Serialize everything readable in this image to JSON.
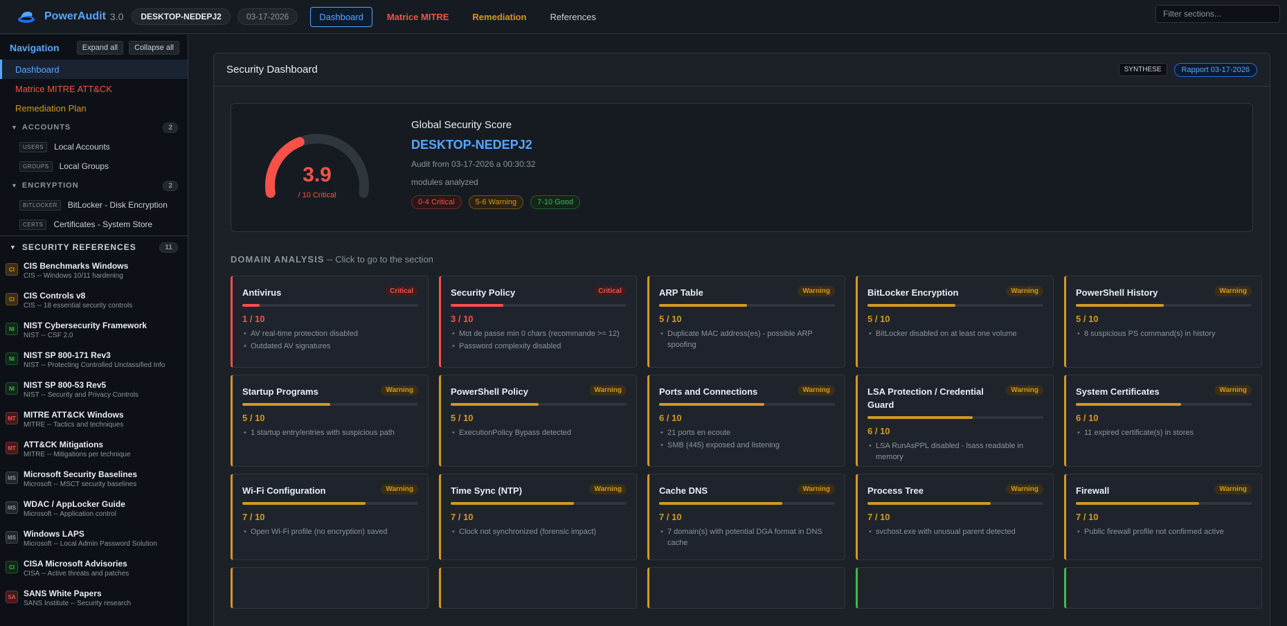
{
  "topbar": {
    "brand": "PowerAudit",
    "version": "3.0",
    "host": "DESKTOP-NEDEPJ2",
    "date": "03-17-2026",
    "tabs": [
      "Dashboard",
      "Matrice MITRE",
      "Remediation",
      "References"
    ],
    "filter_placeholder": "Filter sections..."
  },
  "sidebar": {
    "title": "Navigation",
    "expand_label": "Expand all",
    "collapse_label": "Collapse all",
    "top_items": [
      "Dashboard",
      "Matrice MITRE ATT&CK",
      "Remediation Plan"
    ],
    "groups": [
      {
        "label": "ACCOUNTS",
        "count": "2",
        "items": [
          {
            "tag": "USERS",
            "label": "Local Accounts"
          },
          {
            "tag": "GROUPS",
            "label": "Local Groups"
          }
        ]
      },
      {
        "label": "ENCRYPTION",
        "count": "2",
        "items": [
          {
            "tag": "BITLOCKER",
            "label": "BitLocker - Disk Encryption"
          },
          {
            "tag": "CERTS",
            "label": "Certificates - System Store"
          }
        ]
      }
    ],
    "refs_label": "SECURITY REFERENCES",
    "refs_count": "11",
    "refs": [
      {
        "badge": "CI",
        "title": "CIS Benchmarks Windows",
        "sub": "CIS -- Windows 10/11 hardening",
        "color": "#d29922",
        "bg": "#3a2e15"
      },
      {
        "badge": "CI",
        "title": "CIS Controls v8",
        "sub": "CIS -- 18 essential security controls",
        "color": "#d29922",
        "bg": "#3a2e15"
      },
      {
        "badge": "NI",
        "title": "NIST Cybersecurity Framework",
        "sub": "NIST -- CSF 2.0",
        "color": "#3fb950",
        "bg": "#12261a"
      },
      {
        "badge": "NI",
        "title": "NIST SP 800-171 Rev3",
        "sub": "NIST -- Protecting Controlled Unclassified Info",
        "color": "#3fb950",
        "bg": "#12261a"
      },
      {
        "badge": "NI",
        "title": "NIST SP 800-53 Rev5",
        "sub": "NIST -- Security and Privacy Controls",
        "color": "#3fb950",
        "bg": "#12261a"
      },
      {
        "badge": "MT",
        "title": "MITRE ATT&CK Windows",
        "sub": "MITRE -- Tactics and techniques",
        "color": "#f85149",
        "bg": "#3d1d1f"
      },
      {
        "badge": "MT",
        "title": "ATT&CK Mitigations",
        "sub": "MITRE -- Mitigations per technique",
        "color": "#f85149",
        "bg": "#3d1d1f"
      },
      {
        "badge": "MS",
        "title": "Microsoft Security Baselines",
        "sub": "Microsoft -- MSCT security baselines",
        "color": "#8b949e",
        "bg": "#21262d"
      },
      {
        "badge": "MS",
        "title": "WDAC / AppLocker Guide",
        "sub": "Microsoft -- Application control",
        "color": "#8b949e",
        "bg": "#21262d"
      },
      {
        "badge": "MS",
        "title": "Windows LAPS",
        "sub": "Microsoft -- Local Admin Password Solution",
        "color": "#8b949e",
        "bg": "#21262d"
      },
      {
        "badge": "CI",
        "title": "CISA Microsoft Advisories",
        "sub": "CISA -- Active threats and patches",
        "color": "#3fb950",
        "bg": "#12261a"
      },
      {
        "badge": "SA",
        "title": "SANS White Papers",
        "sub": "SANS Institute -- Security research",
        "color": "#f85149",
        "bg": "#3d1d1f"
      }
    ]
  },
  "panel": {
    "title": "Security Dashboard",
    "badge1": "SYNTHESE",
    "badge2": "Rapport 03-17-2026"
  },
  "score": {
    "value": "3.9",
    "value_num": 3.9,
    "max": 10,
    "label": "/ 10 Critical",
    "heading": "Global Security Score",
    "host": "DESKTOP-NEDEPJ2",
    "audit": "Audit from 03-17-2026 a 00:30:32",
    "modules": "modules analyzed",
    "legend": [
      "0-4 Critical",
      "5-6 Warning",
      "7-10 Good"
    ]
  },
  "domain": {
    "title": "DOMAIN ANALYSIS",
    "hint": " -- Click to go to the section"
  },
  "colors": {
    "critical": "#f85149",
    "warning": "#d29922",
    "good": "#3fb950",
    "accent": "#58a6ff"
  },
  "cards": [
    {
      "title": "Antivirus",
      "severity": "Critical",
      "score": 1,
      "score_text": "1 / 10",
      "findings": [
        "AV real-time protection disabled",
        "Outdated AV signatures"
      ]
    },
    {
      "title": "Security Policy",
      "severity": "Critical",
      "score": 3,
      "score_text": "3 / 10",
      "findings": [
        "Mot de passe min 0 chars (recommande >= 12)",
        "Password complexity disabled"
      ]
    },
    {
      "title": "ARP Table",
      "severity": "Warning",
      "score": 5,
      "score_text": "5 / 10",
      "findings": [
        "Duplicate MAC address(es) - possible ARP spoofing"
      ]
    },
    {
      "title": "BitLocker Encryption",
      "severity": "Warning",
      "score": 5,
      "score_text": "5 / 10",
      "findings": [
        "BitLocker disabled on at least one volume"
      ]
    },
    {
      "title": "PowerShell History",
      "severity": "Warning",
      "score": 5,
      "score_text": "5 / 10",
      "findings": [
        "8 suspicious PS command(s) in history"
      ]
    },
    {
      "title": "Startup Programs",
      "severity": "Warning",
      "score": 5,
      "score_text": "5 / 10",
      "findings": [
        "1 startup entry/entries with suspicious path"
      ]
    },
    {
      "title": "PowerShell Policy",
      "severity": "Warning",
      "score": 5,
      "score_text": "5 / 10",
      "findings": [
        "ExecutionPolicy Bypass detected"
      ]
    },
    {
      "title": "Ports and Connections",
      "severity": "Warning",
      "score": 6,
      "score_text": "6 / 10",
      "findings": [
        "21 ports en ecoute",
        "SMB (445) exposed and listening"
      ]
    },
    {
      "title": "LSA Protection / Credential Guard",
      "severity": "Warning",
      "score": 6,
      "score_text": "6 / 10",
      "findings": [
        "LSA RunAsPPL disabled - lsass readable in memory"
      ]
    },
    {
      "title": "System Certificates",
      "severity": "Warning",
      "score": 6,
      "score_text": "6 / 10",
      "findings": [
        "11 expired certificate(s) in stores"
      ]
    },
    {
      "title": "Wi-Fi Configuration",
      "severity": "Warning",
      "score": 7,
      "score_text": "7 / 10",
      "findings": [
        "Open Wi-Fi profile (no encryption) saved"
      ]
    },
    {
      "title": "Time Sync (NTP)",
      "severity": "Warning",
      "score": 7,
      "score_text": "7 / 10",
      "findings": [
        "Clock not synchronized (forensic impact)"
      ]
    },
    {
      "title": "Cache DNS",
      "severity": "Warning",
      "score": 7,
      "score_text": "7 / 10",
      "findings": [
        "7 domain(s) with potential DGA format in DNS cache"
      ]
    },
    {
      "title": "Process Tree",
      "severity": "Warning",
      "score": 7,
      "score_text": "7 / 10",
      "findings": [
        "svchost.exe with unusual parent detected"
      ]
    },
    {
      "title": "Firewall",
      "severity": "Warning",
      "score": 7,
      "score_text": "7 / 10",
      "findings": [
        "Public firewall profile not confirmed active"
      ]
    }
  ]
}
